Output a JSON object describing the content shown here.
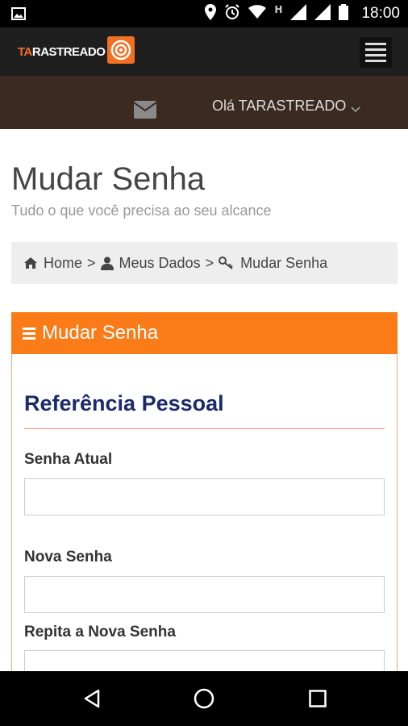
{
  "status_bar": {
    "time": "18:00",
    "network_letter": "H",
    "icons": [
      "image-icon",
      "location-icon",
      "alarm-icon",
      "wifi-icon",
      "signal-icon",
      "signal-icon",
      "battery-icon"
    ]
  },
  "header": {
    "logo_prefix": "TA",
    "logo_rest": "RASTREADO",
    "menu_icon": "hamburger-icon"
  },
  "user_bar": {
    "greeting": "Olá TARASTREADO",
    "mail_icon": "envelope-icon",
    "chevron_icon": "chevron-down-icon"
  },
  "page": {
    "title": "Mudar Senha",
    "subtitle": "Tudo o que você precisa ao seu alcance"
  },
  "breadcrumb": {
    "items": [
      {
        "label": "Home",
        "icon": "home-icon"
      },
      {
        "label": "Meus Dados",
        "icon": "user-icon"
      },
      {
        "label": "Mudar Senha",
        "icon": "key-icon"
      }
    ],
    "separator": ">"
  },
  "panel": {
    "title": "Mudar Senha",
    "section_title": "Referência Pessoal",
    "fields": [
      {
        "label": "Senha Atual",
        "value": ""
      },
      {
        "label": "Nova Senha",
        "value": ""
      },
      {
        "label": "Repita a Nova Senha",
        "value": ""
      }
    ]
  },
  "colors": {
    "accent": "#fb7b18",
    "header_bg": "#1f1f1f",
    "user_bar_bg": "#3a2a20",
    "section_title": "#1b2a6b"
  }
}
